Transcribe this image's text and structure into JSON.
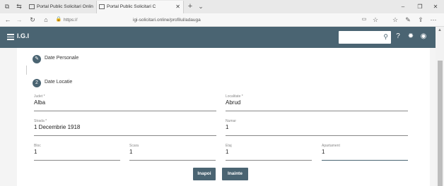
{
  "browser": {
    "tabs": [
      {
        "label": "Portal Public Solicitari Onlin"
      },
      {
        "label": "Portal Public Solicitari C"
      }
    ],
    "url_scheme": "https://",
    "url_path": "igi-solicitari.online/profilul/adauga"
  },
  "app": {
    "title": "I.G.I",
    "colors": {
      "primary": "#4a6472"
    }
  },
  "steps": [
    {
      "number": "",
      "label": "Date Personale",
      "icon": "pencil-icon"
    },
    {
      "number": "2",
      "label": "Date Locatie"
    }
  ],
  "form": {
    "judet": {
      "label": "Judet *",
      "value": "Alba"
    },
    "localitate": {
      "label": "Localitate *",
      "value": "Abrud"
    },
    "strada": {
      "label": "Strada *",
      "value": "1 Decembrie 1918"
    },
    "numar": {
      "label": "Numar",
      "value": "1"
    },
    "bloc": {
      "label": "Bloc",
      "value": "1"
    },
    "scara": {
      "label": "Scara",
      "value": "1"
    },
    "etaj": {
      "label": "Etaj",
      "value": "1"
    },
    "apartament": {
      "label": "Apartament",
      "value": "1"
    }
  },
  "buttons": {
    "back": "Inapoi",
    "next": "Inainte"
  }
}
